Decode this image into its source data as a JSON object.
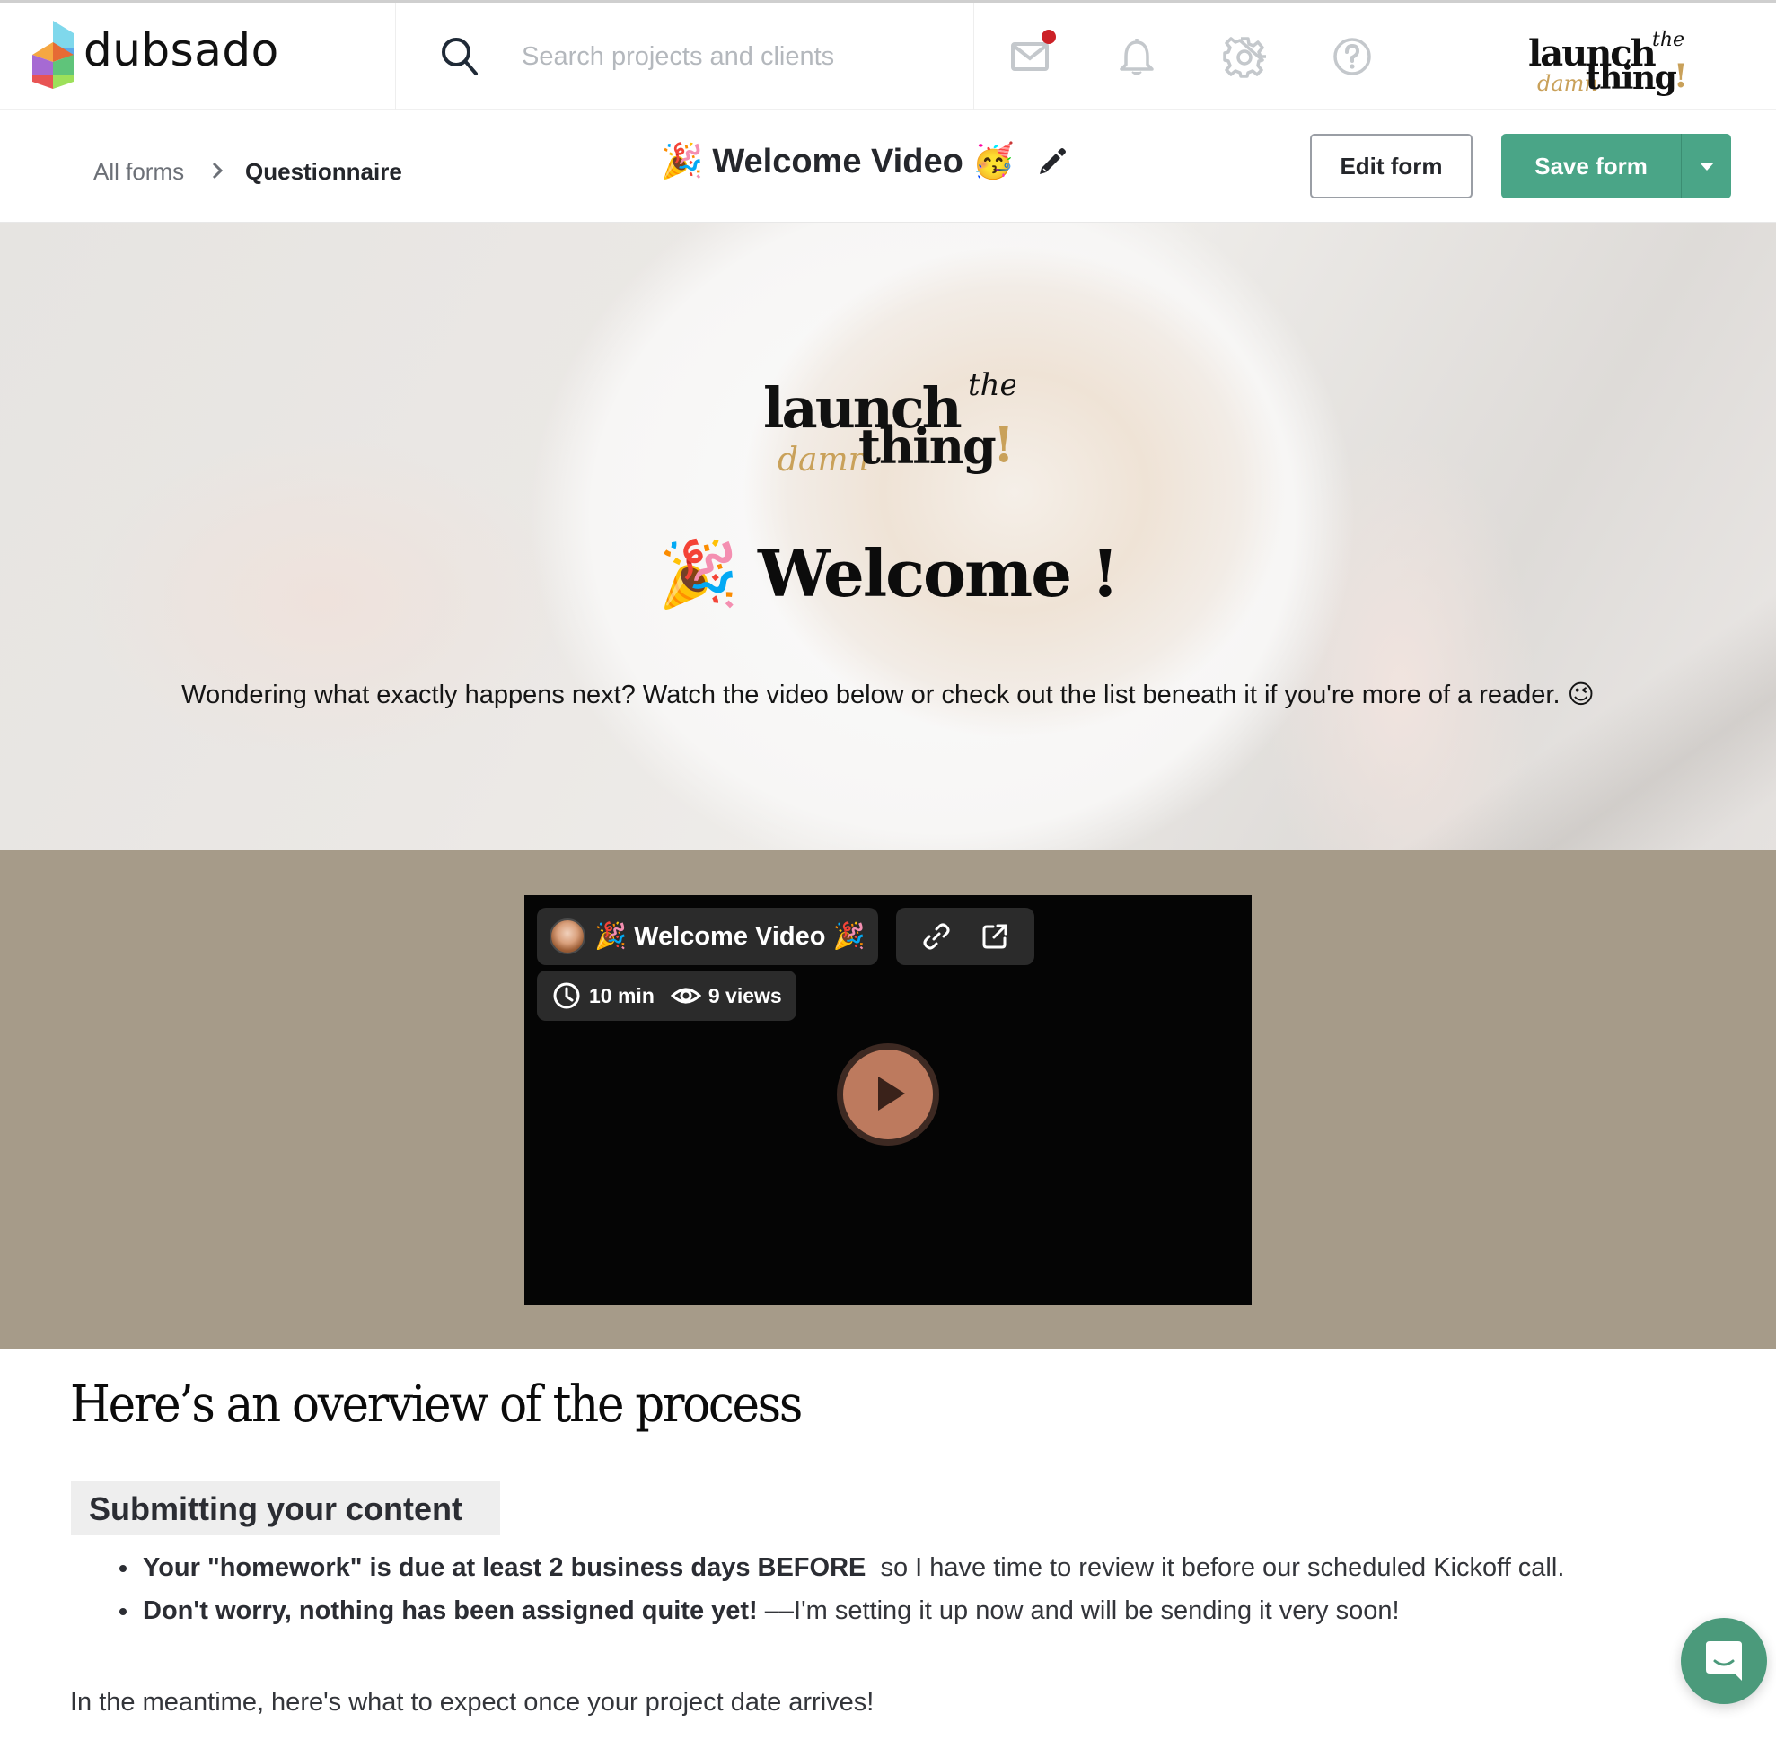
{
  "app": {
    "brand_name": "dubsado",
    "brand_colors": [
      "#7fd8ec",
      "#5aa9ea",
      "#f5a742",
      "#e66a35",
      "#a66ad3",
      "#5fc47a",
      "#e85454",
      "#9de05a"
    ]
  },
  "header": {
    "search_placeholder": "Search projects and clients",
    "search_value": "",
    "icons": [
      "mail-icon",
      "bell-icon",
      "gear-icon",
      "help-icon"
    ],
    "mail_has_notification": true,
    "notification_color": "#cc2127",
    "client_logo": {
      "line1": "launch",
      "line1_script": "the",
      "line2_script": "damn",
      "line2": "thing",
      "exclaim": "!"
    }
  },
  "subheader": {
    "breadcrumb": {
      "all_forms": "All forms",
      "current": "Questionnaire"
    },
    "form_title_prefix": "🎉",
    "form_title": "Welcome Video",
    "form_title_suffix": "🥳",
    "edit_button": "Edit form",
    "save_button": "Save form",
    "accent_color": "#4aa587"
  },
  "hero": {
    "logo": {
      "line1": "launch",
      "line1_script": "the",
      "line2_script": "damn",
      "line2": "thing",
      "exclaim": "!"
    },
    "title_emoji": "🎉",
    "title": "Welcome !",
    "subtitle": "Wondering what exactly happens next? Watch the video below or check out the list beneath it if you're more of a reader. 😉"
  },
  "video": {
    "title": "🎉 Welcome Video 🎉",
    "duration": "10 min",
    "views": "9 views",
    "band_color": "#a69b89",
    "play_color": "#bd7a5e"
  },
  "content": {
    "overview_title": "Here’s an overview of the process",
    "section_heading": "Submitting your content",
    "bullets": [
      {
        "bold": "Your \"homework\" is due at least 2 business days BEFORE",
        "rest": "  so I have time to review it before our scheduled Kickoff call."
      },
      {
        "bold": "Don't worry, nothing has been assigned quite yet!",
        "rest": " ––I'm setting it up now and will be sending it very soon!"
      }
    ],
    "meantime": "In the meantime, here's what to expect once your project date arrives!"
  },
  "chat": {
    "color": "#4b9a7b"
  }
}
